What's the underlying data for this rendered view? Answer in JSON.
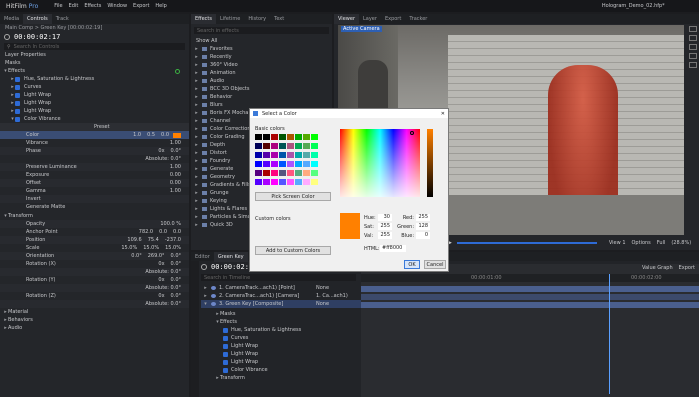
{
  "app": {
    "title": "HitFilm",
    "edition": "Pro",
    "menu": [
      "File",
      "Edit",
      "Effects",
      "Window",
      "Export",
      "Help"
    ],
    "project": "Hologram_Demo_02.hfp*"
  },
  "left": {
    "tabs": [
      "Media",
      "Controls",
      "Track"
    ],
    "breadcrumb": "Main Comp > Green Key [00:00:02:19]",
    "timecode": "00:00:02:17",
    "search_placeholder": "Search In Controls",
    "sections": {
      "layer_props": "Layer Properties",
      "masks": "Masks",
      "effects": "Effects",
      "transform": "Transform",
      "material": "Material",
      "behaviors": "Behaviors",
      "audio": "Audio"
    },
    "effects": [
      "Hue, Saturation & Lightness",
      "Curves",
      "Light Wrap",
      "Light Wrap",
      "Light Wrap",
      "Color Vibrance"
    ],
    "preset_label": "Preset",
    "props": [
      {
        "name": "Color",
        "vals": [
          "1.0",
          "0.5",
          "0.0"
        ]
      },
      {
        "name": "Vibrance",
        "vals": [
          "1.00"
        ]
      },
      {
        "name": "Phase",
        "vals": [
          "0x",
          "0.0°"
        ]
      },
      {
        "name": "",
        "vals": [
          "Absolute: 0.0°"
        ]
      },
      {
        "name": "Preserve Luminance",
        "vals": [
          "1.00"
        ]
      },
      {
        "name": "Exposure",
        "vals": [
          "0.00"
        ]
      },
      {
        "name": "Offset",
        "vals": [
          "0.00"
        ]
      },
      {
        "name": "Gamma",
        "vals": [
          "1.00"
        ]
      },
      {
        "name": "Invert",
        "vals": [
          ""
        ]
      },
      {
        "name": "Generate Matte",
        "vals": [
          ""
        ]
      }
    ],
    "transform": [
      {
        "name": "Opacity",
        "vals": [
          "100.0 %"
        ]
      },
      {
        "name": "Anchor Point",
        "vals": [
          "782.0",
          "0.0",
          "0.0"
        ]
      },
      {
        "name": "Position",
        "vals": [
          "109.6",
          "75.4",
          "-237.0"
        ]
      },
      {
        "name": "Scale",
        "vals": [
          "15.0%",
          "15.0%",
          "15.0%"
        ]
      },
      {
        "name": "Orientation",
        "vals": [
          "0.0°",
          "269.0°",
          "0.0°"
        ]
      },
      {
        "name": "Rotation (X)",
        "vals": [
          "0x",
          "0.0°"
        ]
      },
      {
        "name": "",
        "vals": [
          "Absolute: 0.0°"
        ]
      },
      {
        "name": "Rotation (Y)",
        "vals": [
          "0x",
          "0.0°"
        ]
      },
      {
        "name": "",
        "vals": [
          "Absolute: 0.0°"
        ]
      },
      {
        "name": "Rotation (Z)",
        "vals": [
          "0x",
          "0.0°"
        ]
      },
      {
        "name": "",
        "vals": [
          "Absolute: 0.0°"
        ]
      }
    ]
  },
  "effects_panel": {
    "tabs": [
      "Effects",
      "Lifetime",
      "History",
      "Text"
    ],
    "search_placeholder": "Search in effects",
    "show": "Show All",
    "categories": [
      "Favorites",
      "Recently",
      "360° Video",
      "Animation",
      "Audio",
      "BCC 3D Objects",
      "Behavior",
      "Blurs",
      "Boris FX Mocha",
      "Channel",
      "Color Correction",
      "Color Grading",
      "Depth",
      "Distort",
      "Foundry",
      "Generate",
      "Geometry",
      "Gradients & Fills",
      "Grunge",
      "Keying",
      "Lights & Flares",
      "Particles & Simulation",
      "Quick 3D"
    ]
  },
  "viewer": {
    "tabs": [
      "Viewer",
      "Layer",
      "Export",
      "Tracker"
    ],
    "camera": "Active Camera",
    "timecode": "00:00:02:17",
    "zoom": "View 1",
    "options": "Options",
    "full": "Full",
    "pct": "(28.8%)"
  },
  "dialog": {
    "title": "Select a Color",
    "basic_colors": "Basic colors",
    "pick_screen": "Pick Screen Color",
    "custom_colors": "Custom colors",
    "add_custom": "Add to Custom Colors",
    "hue_label": "Hue:",
    "hue": "30",
    "sat_label": "Sat:",
    "sat": "255",
    "val_label": "Val:",
    "val": "255",
    "red_label": "Red:",
    "red": "255",
    "green_label": "Green:",
    "green": "128",
    "blue_label": "Blue:",
    "blue": "0",
    "html_label": "HTML:",
    "html": "#ff8000",
    "ok": "OK",
    "cancel": "Cancel",
    "basic_colors_grid": [
      "#000000",
      "#000000",
      "#aa0000",
      "#005500",
      "#aa5500",
      "#00aa00",
      "#55aa00",
      "#00ff00",
      "#000055",
      "#550000",
      "#aa007f",
      "#005555",
      "#aa557f",
      "#00aa55",
      "#55aa55",
      "#00ff55",
      "#0000aa",
      "#5500aa",
      "#aa00aa",
      "#0055aa",
      "#aa55aa",
      "#00aaaa",
      "#55aaaa",
      "#00ffaa",
      "#0000ff",
      "#5500ff",
      "#aa00ff",
      "#0055ff",
      "#aa55ff",
      "#00aaff",
      "#55aaff",
      "#00ffff",
      "#55007f",
      "#aa0000",
      "#ff007f",
      "#55557f",
      "#ff557f",
      "#55aa7f",
      "#ffaa7f",
      "#55ff7f",
      "#5500ff",
      "#aa00ff",
      "#ff00ff",
      "#5555ff",
      "#ff55ff",
      "#55aaff",
      "#ffaaff",
      "#ffff7f"
    ],
    "accent": "#ff8000"
  },
  "editor": {
    "tabs": [
      "Editor",
      "Green Key"
    ],
    "timecode": "00:00:02:17",
    "search_placeholder": "Search in Timeline",
    "layers": [
      "1. CameraTrack...ach1) [Point]",
      "2. CameraTrac...ach1) [Camera]",
      "3. Green Key [Composite]"
    ],
    "parent": [
      "None",
      "1. Ca...ach1)",
      "None"
    ],
    "sub": [
      "Masks",
      "Effects",
      "Hue, Saturation & Lightness",
      "Curves",
      "Light Wrap",
      "Light Wrap",
      "Light Wrap",
      "Color Vibrance",
      "Transform"
    ],
    "value_graph": "Value Graph",
    "export": "Export",
    "ruler": [
      "00:00:01:00",
      "00:00:02:00"
    ]
  }
}
